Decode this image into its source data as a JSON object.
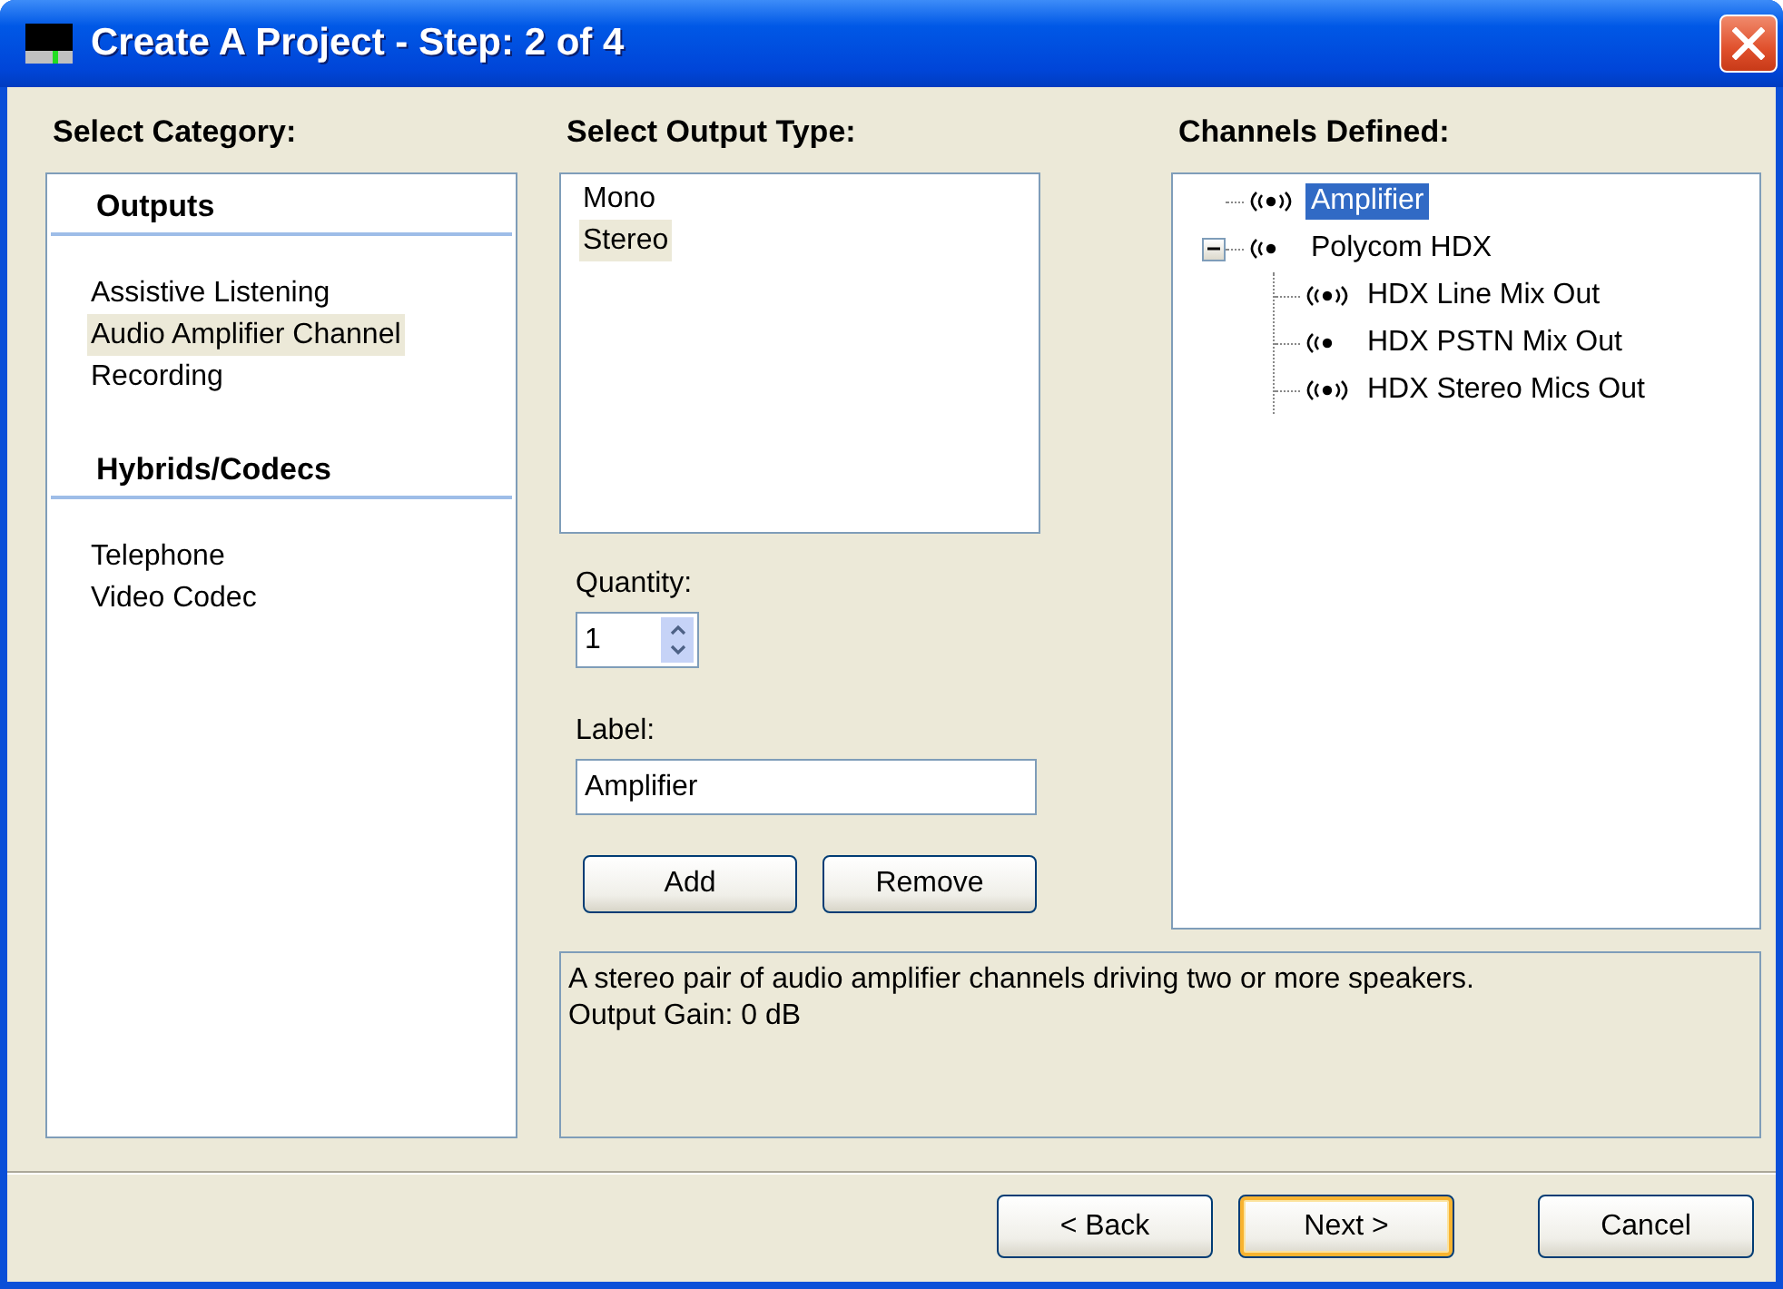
{
  "window": {
    "title": "Create A Project - Step: 2 of 4"
  },
  "category": {
    "heading": "Select Category:",
    "groups": [
      {
        "heading": "Outputs",
        "items": [
          {
            "label": "Assistive Listening",
            "selected": false
          },
          {
            "label": "Audio Amplifier Channel",
            "selected": true
          },
          {
            "label": "Recording",
            "selected": false
          }
        ]
      },
      {
        "heading": "Hybrids/Codecs",
        "items": [
          {
            "label": "Telephone",
            "selected": false
          },
          {
            "label": "Video Codec",
            "selected": false
          }
        ]
      }
    ]
  },
  "output_type": {
    "heading": "Select Output Type:",
    "items": [
      {
        "label": "Mono",
        "selected": false
      },
      {
        "label": "Stereo",
        "selected": true
      }
    ]
  },
  "quantity": {
    "label": "Quantity:",
    "value": "1"
  },
  "label_field": {
    "label": "Label:",
    "value": "Amplifier"
  },
  "actions": [
    "Add",
    "Remove"
  ],
  "channels": {
    "heading": "Channels Defined:",
    "tree": [
      {
        "label": "Amplifier",
        "kind": "stereo",
        "selected": true
      },
      {
        "label": "Polycom HDX",
        "kind": "mono",
        "selected": false,
        "expanded": true,
        "children": [
          {
            "label": "HDX Line Mix Out",
            "kind": "stereo",
            "selected": false
          },
          {
            "label": "HDX PSTN Mix Out",
            "kind": "mono",
            "selected": false
          },
          {
            "label": "HDX Stereo Mics Out",
            "kind": "stereo",
            "selected": false
          }
        ]
      }
    ]
  },
  "description": [
    "A stereo pair of audio amplifier channels driving two or more speakers.",
    "Output Gain: 0 dB"
  ],
  "footer_buttons": [
    {
      "label": "< Back",
      "focused": false
    },
    {
      "label": "Next >",
      "focused": true
    },
    {
      "label": "Cancel",
      "focused": false
    }
  ]
}
